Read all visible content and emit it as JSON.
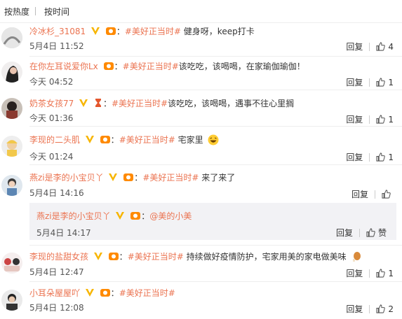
{
  "sort": {
    "hot": "按热度",
    "time": "按时间"
  },
  "actions": {
    "reply": "回复",
    "like": "赞"
  },
  "colors": {
    "link": "#eb7350",
    "vip": "#f7b500",
    "medal": "#ff8a00"
  },
  "comments": [
    {
      "user": "冷冰杉_31081",
      "tag": "#美好正当时#",
      "text": " 健身呀，keep打卡",
      "time": "5月4日 11:52",
      "likes": "4",
      "badges": [
        "vip-v-icon",
        "fan-medal-icon"
      ]
    },
    {
      "user": "在你左耳说爱你Lx",
      "tag": "#美好正当时#",
      "text": "该吃吃，该喝喝，在家瑜伽瑜伽！",
      "time": "今天 04:52",
      "likes": "1",
      "badges": [
        "fan-medal-icon"
      ]
    },
    {
      "user": "奶茶女孩77",
      "tag": "#美好正当时#",
      "text": "该吃吃，该喝喝，遇事不往心里搁",
      "time": "今天 01:36",
      "likes": "1",
      "badges": [
        "vip-v-icon",
        "hourglass-icon"
      ]
    },
    {
      "user": "李现的二头肌",
      "tag": "#美好正当时#",
      "text": " 宅家里",
      "time": "今天 01:24",
      "likes": "1",
      "badges": [
        "vip-v-icon",
        "fan-medal-icon"
      ]
    },
    {
      "user": "燕zi是李的小宝贝丫",
      "tag": "#美好正当时#",
      "text": " 来了来了",
      "time": "5月4日 14:16",
      "likes": "",
      "badges": [
        "vip-v-icon",
        "fan-medal-icon"
      ]
    },
    {
      "user": "李现的盐甜女孩",
      "tag": "#美好正当时#",
      "text": " 持续做好疫情防护，宅家用美的家电做美味",
      "time": "5月4日 12:47",
      "likes": "1",
      "badges": [
        "vip-v-icon",
        "fan-medal-icon"
      ]
    },
    {
      "user": "小耳朵屋屋吖",
      "tag": "#美好正当时#",
      "text": "",
      "time": "5月4日 12:08",
      "likes": "2",
      "badges": [
        "vip-v-icon",
        "fan-medal-icon"
      ]
    }
  ],
  "subreply": {
    "user": "燕zi是李的小宝贝丫",
    "mention": "@美的小美",
    "time": "5月4日 14:17"
  }
}
